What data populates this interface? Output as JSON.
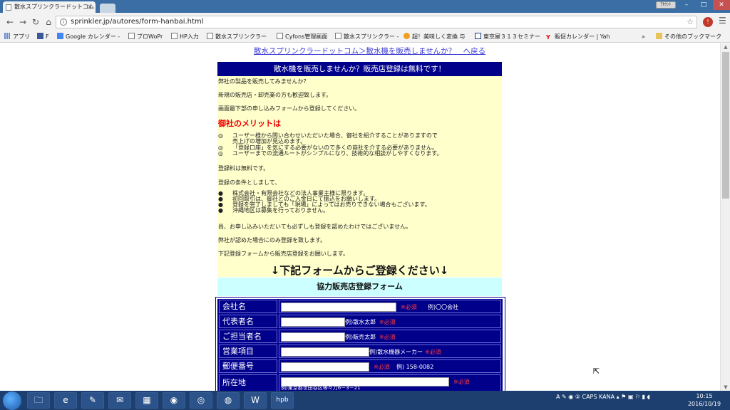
{
  "browser": {
    "tab_title": "散水スプリンクラードットコム",
    "url": "sprinkler.jp/autores/form-hanbai.html",
    "user_badge": "ｱｶｳﾝﾄ",
    "bookmarks": [
      {
        "icon": "apps-icon",
        "label": "アプリ"
      },
      {
        "icon": "facebook-icon",
        "label": "F"
      },
      {
        "icon": "google-calendar-icon",
        "label": "Google カレンダー -"
      },
      {
        "icon": "page-icon",
        "label": "ブロWoPr"
      },
      {
        "icon": "page-icon",
        "label": "HP入力"
      },
      {
        "icon": "page-icon",
        "label": "散水スプリンクラー"
      },
      {
        "icon": "page-icon",
        "label": "Cyfons管理画面"
      },
      {
        "icon": "page-icon",
        "label": "散水スプリンクラー -"
      },
      {
        "icon": "orange-icon",
        "label": "超！美味しく変換 与"
      },
      {
        "icon": "k-icon",
        "label": "東京屋３１３セミナー"
      },
      {
        "icon": "yahoo-icon",
        "label": "販促カレンダー | Yah"
      }
    ],
    "bookmarks_overflow": "»",
    "other_bookmarks": "その他のブックマーク"
  },
  "page": {
    "breadcrumb": "散水スプリンクラードットコム＞散水機を販売しませんか？　へ戻る",
    "header": "散水機を販売しませんか？販売店登録は無料です！",
    "intro": [
      "弊社の製品を販売してみませんか？",
      "新規の販売店・卸売業の方も歓迎致します。",
      "画面最下部の申し込みフォームから登録してください。"
    ],
    "merit_title": "御社のメリットは",
    "merits": [
      {
        "mark": "◎",
        "text": "ユーザー様から問い合わせいただいた場合、御社を紹介することがありますので",
        "cont": "売上げの増加が見込めます。"
      },
      {
        "mark": "◎",
        "text": "「登録口座」を気にする必要がないので多くの商社を介する必要がありません。",
        "cont": ""
      },
      {
        "mark": "◎",
        "text": "ユーザーまでの流通ルートがシンプルになり、技術的な相談がしやすくなります。",
        "cont": ""
      }
    ],
    "free_note": "登録料は無料です。",
    "conditions_intro": "登録の条件としまして、",
    "conditions": [
      {
        "mark": "●",
        "text": "株式会社・有限会社などの法人事業主様に限ります。"
      },
      {
        "mark": "●",
        "text": "初回取引は、御社とのご入金日にて振込をお願いします。"
      },
      {
        "mark": "●",
        "text": "登録を完了しましても「現場」によってはお売りできない場合もございます。"
      },
      {
        "mark": "●",
        "text": "沖縄地区は募集を行っておりません。"
      }
    ],
    "notes": [
      "尚、お申し込みいただいても必ずしも登録を認めたわけではございません。",
      "弊社が認めた場合にのみ登録を致します。",
      "下記登録フォームから販売店登録をお願いします。"
    ],
    "cta": "↓下記フォームからご登録ください↓",
    "form_title": "協力販売店登録フォーム",
    "form_rows": [
      {
        "label": "会社名",
        "required": "※必須",
        "example": "例)〇〇会社"
      },
      {
        "label": "代表者名",
        "example": "例)散水太郎",
        "required": "※必須"
      },
      {
        "label": "ご担当者名",
        "example": "例)販売太郎",
        "required": "※必須"
      },
      {
        "label": "営業項目",
        "example": "例)散水機器メーカー",
        "required": "※必須"
      },
      {
        "label": "郵便番号",
        "required": "※必須",
        "example": "例) 158-0082"
      },
      {
        "label": "所在地",
        "required": "※必須",
        "example": "例)東京都世田谷区等々力6－3－21"
      }
    ]
  },
  "taskbar": {
    "apps": [
      {
        "icon": "explorer-icon",
        "glyph": "🗀"
      },
      {
        "icon": "ie-icon",
        "glyph": "e"
      },
      {
        "icon": "tool-icon",
        "glyph": "✎"
      },
      {
        "icon": "mail-icon",
        "glyph": "✉"
      },
      {
        "icon": "calc-icon",
        "glyph": "▦"
      },
      {
        "icon": "firefox-icon",
        "glyph": "◉"
      },
      {
        "icon": "chrome-icon",
        "glyph": "◎"
      },
      {
        "icon": "globe-icon",
        "glyph": "◍"
      },
      {
        "icon": "word-icon",
        "glyph": "W"
      },
      {
        "icon": "hpb-icon",
        "glyph": "hpb"
      }
    ],
    "tray": "A ✎ ◉ ② CAPS KANA ▴ ⚑ ▣ ⚐ ▮ ◖",
    "time": "10:15",
    "date": "2016/10/19"
  }
}
